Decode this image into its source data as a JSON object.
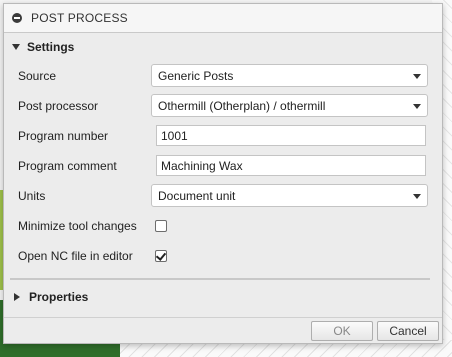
{
  "dialog": {
    "title": "POST PROCESS"
  },
  "settings": {
    "header": "Settings",
    "source": {
      "label": "Source",
      "value": "Generic Posts"
    },
    "post_processor": {
      "label": "Post processor",
      "value": "Othermill (Otherplan) / othermill"
    },
    "program_number": {
      "label": "Program number",
      "value": "1001"
    },
    "program_comment": {
      "label": "Program comment",
      "value": "Machining Wax"
    },
    "units": {
      "label": "Units",
      "value": "Document unit"
    },
    "minimize_tool_changes": {
      "label": "Minimize tool changes",
      "checked": false
    },
    "open_nc_file": {
      "label": "Open NC file in editor",
      "checked": true
    }
  },
  "properties": {
    "header": "Properties"
  },
  "buttons": {
    "ok": "OK",
    "cancel": "Cancel"
  },
  "icons": {
    "title": "minus-circle-icon",
    "settings_toggle": "triangle-down-icon",
    "properties_toggle": "triangle-right-icon",
    "dropdown": "chevron-down-icon",
    "check": "checkmark-icon"
  }
}
